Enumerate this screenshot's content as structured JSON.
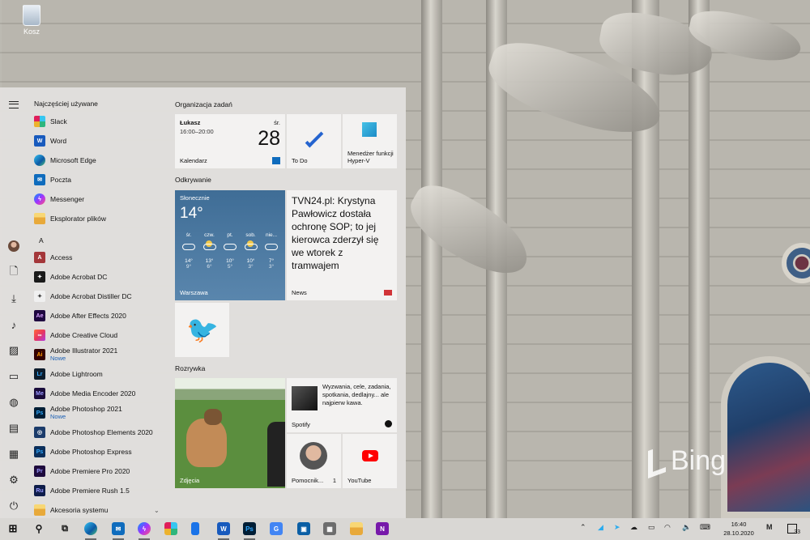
{
  "desktop": {
    "recycle_bin_label": "Kosz"
  },
  "start_menu": {
    "most_used_heading": "Najczęściej używane",
    "letter_a": "A",
    "most_used": [
      {
        "name": "Slack",
        "icon": "slack-icon"
      },
      {
        "name": "Word",
        "icon": "word-icon"
      },
      {
        "name": "Microsoft Edge",
        "icon": "edge-icon"
      },
      {
        "name": "Poczta",
        "icon": "mail-icon"
      },
      {
        "name": "Messenger",
        "icon": "messenger-icon"
      },
      {
        "name": "Eksplorator plików",
        "icon": "folder-icon"
      }
    ],
    "apps_a": [
      {
        "name": "Access",
        "sub": "",
        "icon": "access-icon",
        "color": "#a4373a",
        "glyph": "A"
      },
      {
        "name": "Adobe Acrobat DC",
        "sub": "",
        "icon": "acrobat-icon",
        "color": "#1a1a1a",
        "glyph": "✦"
      },
      {
        "name": "Adobe Acrobat Distiller DC",
        "sub": "",
        "icon": "distiller-icon",
        "color": "#f0f0f0",
        "glyph": "✦"
      },
      {
        "name": "Adobe After Effects 2020",
        "sub": "",
        "icon": "after-effects-icon",
        "color": "#1f0740",
        "glyph": "Ae"
      },
      {
        "name": "Adobe Creative Cloud",
        "sub": "",
        "icon": "creative-cloud-icon",
        "color": "#e8365d",
        "glyph": "∞"
      },
      {
        "name": "Adobe Illustrator 2021",
        "sub": "Nowe",
        "icon": "illustrator-icon",
        "color": "#330000",
        "glyph": "Ai"
      },
      {
        "name": "Adobe Lightroom",
        "sub": "",
        "icon": "lightroom-icon",
        "color": "#0d1c2c",
        "glyph": "Lr"
      },
      {
        "name": "Adobe Media Encoder 2020",
        "sub": "",
        "icon": "media-encoder-icon",
        "color": "#1a0c3b",
        "glyph": "Me"
      },
      {
        "name": "Adobe Photoshop 2021",
        "sub": "Nowe",
        "icon": "photoshop-icon",
        "color": "#001e36",
        "glyph": "Ps"
      },
      {
        "name": "Adobe Photoshop Elements 2020",
        "sub": "",
        "icon": "photoshop-elements-icon",
        "color": "#1b3b6a",
        "glyph": "◎"
      },
      {
        "name": "Adobe Photoshop Express",
        "sub": "",
        "icon": "photoshop-express-icon",
        "color": "#0b2f5b",
        "glyph": "Ps"
      },
      {
        "name": "Adobe Premiere Pro 2020",
        "sub": "",
        "icon": "premiere-pro-icon",
        "color": "#1e0b3d",
        "glyph": "Pr"
      },
      {
        "name": "Adobe Premiere Rush 1.5",
        "sub": "",
        "icon": "premiere-rush-icon",
        "color": "#0f1d4a",
        "glyph": "Ru"
      },
      {
        "name": "Akcesoria systemu",
        "sub": "",
        "icon": "folder-icon",
        "color": "#e8b84a",
        "glyph": ""
      }
    ],
    "groups": {
      "productivity": "Organizacja zadań",
      "discover": "Odkrywanie",
      "entertainment": "Rozrywka"
    },
    "tiles": {
      "calendar": {
        "name": "Łukasz",
        "time": "16:00–20:00",
        "weekday": "śr.",
        "date": "28",
        "label": "Kalendarz"
      },
      "todo": {
        "label": "To Do"
      },
      "hyperv": {
        "label": "Menedżer funkcji Hyper-V"
      },
      "weather": {
        "title": "Słonecznie",
        "temp": "14°",
        "city": "Warszawa",
        "days": [
          {
            "day": "śr.",
            "hi": "14°",
            "lo": "9°",
            "icon": "cloud-icon"
          },
          {
            "day": "czw.",
            "hi": "13°",
            "lo": "6°",
            "icon": "partly-sunny-icon"
          },
          {
            "day": "pt.",
            "hi": "10°",
            "lo": "5°",
            "icon": "cloud-icon"
          },
          {
            "day": "sob.",
            "hi": "10°",
            "lo": "3°",
            "icon": "partly-sunny-icon"
          },
          {
            "day": "nie...",
            "hi": "7°",
            "lo": "3°",
            "icon": "cloud-icon"
          }
        ]
      },
      "news": {
        "headline": "TVN24.pl: Krystyna Pawłowicz dostała ochronę SOP; to jej kierowca zderzył się we wtorek z tramwajem",
        "label": "News"
      },
      "twitter": {
        "label": ""
      },
      "photos": {
        "label": "Zdjęcia"
      },
      "spotify": {
        "text": "Wyzwania, cele, zadania, spotkania, dedlajny... ale najpierw kawa.",
        "label": "Spotify"
      },
      "people": {
        "label": "Pomocnik...",
        "count": "1"
      },
      "youtube": {
        "label": "YouTube"
      }
    }
  },
  "taskbar": {
    "time": "16:40",
    "date": "28.10.2020",
    "notifications": "33"
  },
  "wallpaper": {
    "brand": "Bing"
  }
}
